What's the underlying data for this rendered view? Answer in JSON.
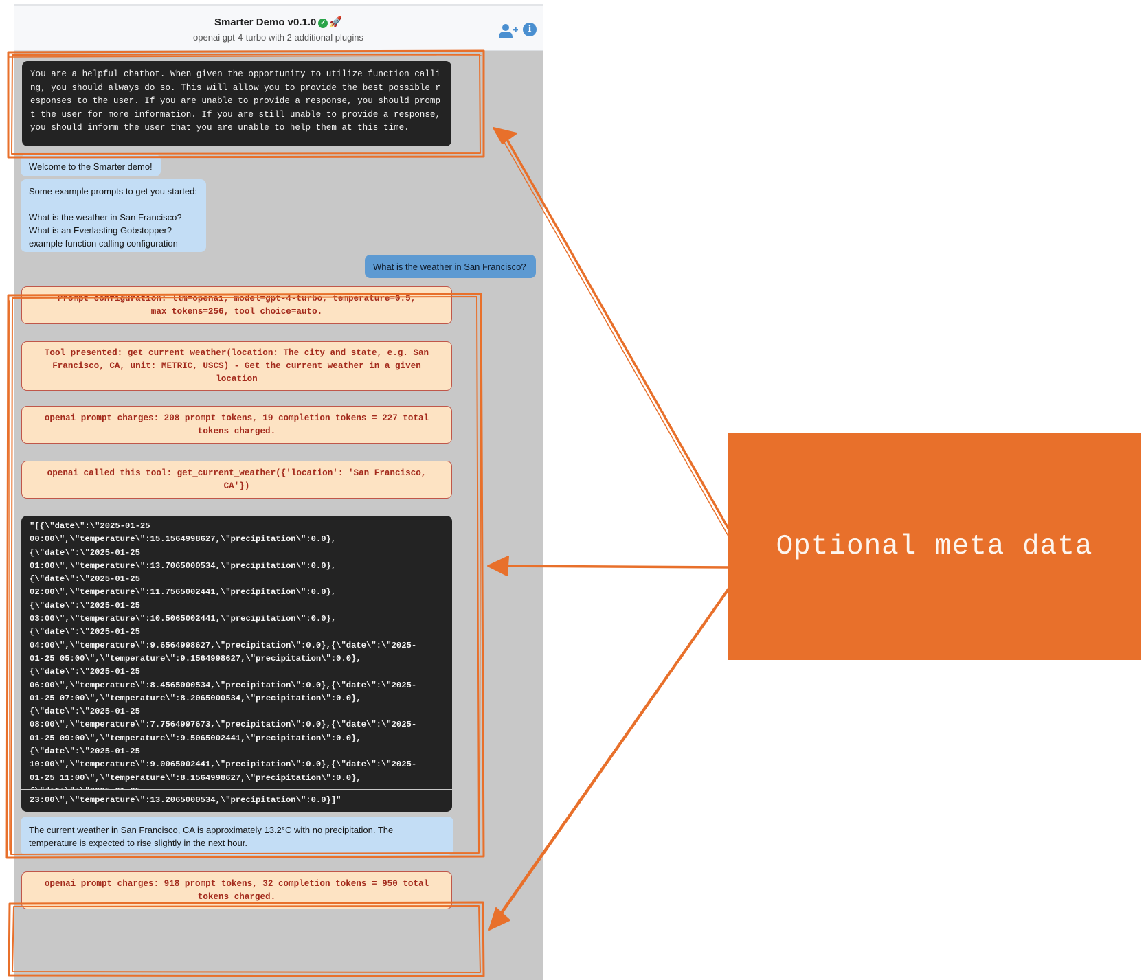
{
  "header": {
    "title": "Smarter Demo v0.1.0",
    "subtitle": "openai gpt-4-turbo with 2 additional plugins",
    "icons": [
      "verified-check-icon",
      "rocket-icon",
      "add-user-icon",
      "info-icon"
    ]
  },
  "messages": {
    "system_prompt": "You are a helpful chatbot. When given the opportunity to utilize function calling, you should always do so. This will allow you to provide the best possible responses to the user. If you are unable to provide a response, you should prompt the user for more information. If you are still unable to provide a response, you should inform the user that you are unable to help them at this time.",
    "welcome": "Welcome to the Smarter demo!",
    "examples": "Some example prompts to get you started:\n\nWhat is the weather in San Francisco?\nWhat is an Everlasting Gobstopper?\nexample function calling configuration",
    "user_question": "What is the weather in San Francisco?",
    "prompt_config": "Prompt configuration: llm=openai, model=gpt-4-turbo, temperature=0.5,\nmax_tokens=256, tool_choice=auto.",
    "tool_presented": "Tool presented: get_current_weather(location: The city and state, e.g. San\nFrancisco, CA, unit: METRIC, USCS) - Get the current weather in a given\nlocation",
    "prompt_charges_1": "openai prompt charges: 208 prompt tokens, 19 completion tokens = 227 total\ntokens charged.",
    "tool_called": "openai called this tool: get_current_weather({'location': 'San Francisco,\nCA'})",
    "tool_output": "\"[{\\\"date\\\":\\\"2025-01-25\n00:00\\\",\\\"temperature\\\":15.1564998627,\\\"precipitation\\\":0.0},\n{\\\"date\\\":\\\"2025-01-25\n01:00\\\",\\\"temperature\\\":13.7065000534,\\\"precipitation\\\":0.0},\n{\\\"date\\\":\\\"2025-01-25\n02:00\\\",\\\"temperature\\\":11.7565002441,\\\"precipitation\\\":0.0},\n{\\\"date\\\":\\\"2025-01-25\n03:00\\\",\\\"temperature\\\":10.5065002441,\\\"precipitation\\\":0.0},\n{\\\"date\\\":\\\"2025-01-25\n04:00\\\",\\\"temperature\\\":9.6564998627,\\\"precipitation\\\":0.0},{\\\"date\\\":\\\"2025-\n01-25 05:00\\\",\\\"temperature\\\":9.1564998627,\\\"precipitation\\\":0.0},\n{\\\"date\\\":\\\"2025-01-25\n06:00\\\",\\\"temperature\\\":8.4565000534,\\\"precipitation\\\":0.0},{\\\"date\\\":\\\"2025-\n01-25 07:00\\\",\\\"temperature\\\":8.2065000534,\\\"precipitation\\\":0.0},\n{\\\"date\\\":\\\"2025-01-25\n08:00\\\",\\\"temperature\\\":7.7564997673,\\\"precipitation\\\":0.0},{\\\"date\\\":\\\"2025-\n01-25 09:00\\\",\\\"temperature\\\":9.5065002441,\\\"precipitation\\\":0.0},\n{\\\"date\\\":\\\"2025-01-25\n10:00\\\",\\\"temperature\\\":9.0065002441,\\\"precipitation\\\":0.0},{\\\"date\\\":\\\"2025-\n01-25 11:00\\\",\\\"temperature\\\":8.1564998627,\\\"precipitation\\\":0.0},\n{\\\"date\\\":\\\"2025-01-25",
    "tool_output_tail": "23:00\\\",\\\"temperature\\\":13.2065000534,\\\"precipitation\\\":0.0}]\"",
    "assistant_answer": "The current weather in San Francisco, CA is approximately 13.2°C with no precipitation. The\ntemperature is expected to rise slightly in the next hour.",
    "prompt_charges_2": "openai prompt charges: 918 prompt tokens, 32 completion tokens = 950 total\ntokens charged."
  },
  "annotation": {
    "label": "Optional meta data",
    "color": "#e8702b"
  },
  "colors": {
    "system_bubble": "#232323",
    "bot_bubble": "#c3ddf5",
    "user_bubble": "#5d9ad2",
    "meta_bubble": "#fde3c3",
    "meta_text": "#a32a1c"
  }
}
